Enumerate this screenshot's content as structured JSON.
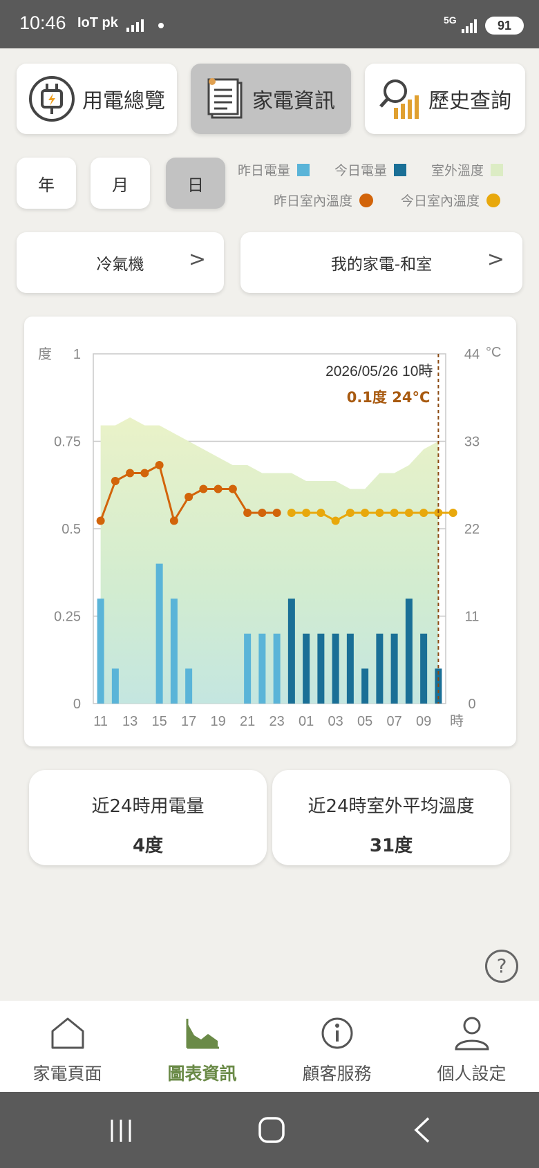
{
  "status": {
    "time": "10:46",
    "left_icons": "IoT pk",
    "network": "5G",
    "battery": "91"
  },
  "top_tabs": [
    {
      "label": "用電總覽",
      "icon": "plug-bolt-icon",
      "active": false
    },
    {
      "label": "家電資訊",
      "icon": "document-icon",
      "active": true
    },
    {
      "label": "歷史查詢",
      "icon": "magnifier-bars-icon",
      "active": false
    }
  ],
  "period_tabs": [
    {
      "label": "年",
      "active": false
    },
    {
      "label": "月",
      "active": false
    },
    {
      "label": "日",
      "active": true
    }
  ],
  "legend": {
    "yesterday_power": "昨日電量",
    "today_power": "今日電量",
    "outdoor_temp": "室外溫度",
    "yesterday_indoor": "昨日室內溫度",
    "today_indoor": "今日室內溫度"
  },
  "colors": {
    "yesterday_power": "#5ab4d8",
    "today_power": "#1a6f96",
    "outdoor_temp": "#dcecc4",
    "yesterday_indoor": "#d2640a",
    "today_indoor": "#e8a80c",
    "active_nav": "#6a8a47"
  },
  "selectors": {
    "device_type": "冷氣機",
    "device_name": "我的家電-和室"
  },
  "chart_data": {
    "type": "bar",
    "left_axis_label": "度",
    "right_axis_label": "°C",
    "x_unit": "時",
    "y_left_ticks": [
      "1",
      "0.75",
      "0.5",
      "0.25",
      "0"
    ],
    "y_right_ticks": [
      "44",
      "33",
      "22",
      "11",
      "0"
    ],
    "ylim_left": [
      0,
      1
    ],
    "ylim_right": [
      0,
      44
    ],
    "x_tick_labels": [
      "11",
      "13",
      "15",
      "17",
      "19",
      "21",
      "23",
      "01",
      "03",
      "05",
      "07",
      "09"
    ],
    "hours": [
      "11",
      "12",
      "13",
      "14",
      "15",
      "16",
      "17",
      "18",
      "19",
      "20",
      "21",
      "22",
      "23",
      "00",
      "01",
      "02",
      "03",
      "04",
      "05",
      "06",
      "07",
      "08",
      "09",
      "10"
    ],
    "power_yesterday": [
      0.3,
      0.1,
      0,
      0,
      0.4,
      0.3,
      0.1,
      0,
      0,
      0,
      0.2,
      0.2,
      0.2
    ],
    "power_today": [
      0.3,
      0.2,
      0.2,
      0.2,
      0.2,
      0.1,
      0.2,
      0.2,
      0.3,
      0.2,
      0.1
    ],
    "outdoor_temp": [
      35,
      35,
      36,
      35,
      35,
      34,
      33,
      32,
      31,
      30,
      30,
      29,
      29,
      29,
      28,
      28,
      28,
      27,
      27,
      29,
      29,
      30,
      32,
      33
    ],
    "indoor_yesterday": [
      23,
      28,
      29,
      29,
      30,
      23,
      26,
      27,
      27,
      27,
      24,
      24,
      24
    ],
    "indoor_today": [
      24,
      24,
      24,
      23,
      24,
      24,
      24,
      24,
      24,
      24,
      24,
      24
    ],
    "tooltip": {
      "datetime": "2026/05/26 10時",
      "value": "0.1度 24°C"
    }
  },
  "summary": [
    {
      "title": "近24時用電量",
      "value": "4度"
    },
    {
      "title": "近24時室外平均溫度",
      "value": "31度"
    }
  ],
  "help_label": "?",
  "nav": [
    {
      "label": "家電頁面",
      "icon": "home-icon",
      "active": false
    },
    {
      "label": "圖表資訊",
      "icon": "chart-icon",
      "active": true
    },
    {
      "label": "顧客服務",
      "icon": "info-icon",
      "active": false
    },
    {
      "label": "個人設定",
      "icon": "user-icon",
      "active": false
    }
  ]
}
